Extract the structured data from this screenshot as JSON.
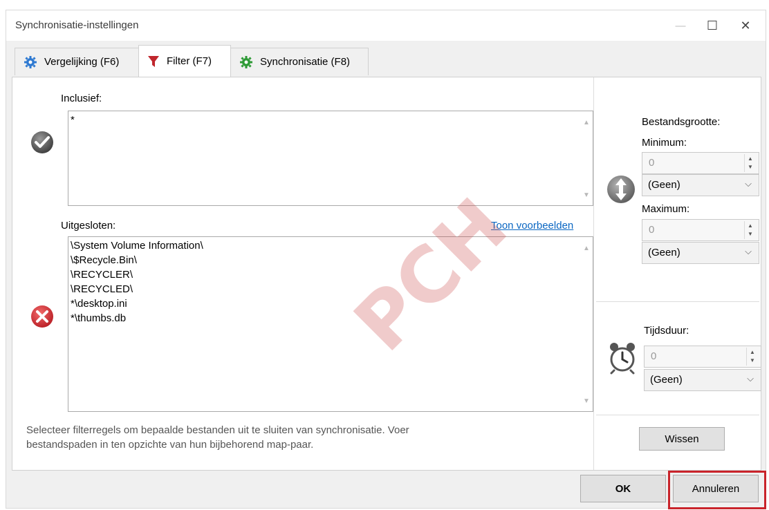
{
  "window": {
    "title": "Synchronisatie-instellingen",
    "controls": {
      "minimize": "—",
      "maximize": "☐",
      "close": "✕"
    }
  },
  "tabs": [
    {
      "label": "Vergelijking (F6)",
      "icon": "gear-icon-blue"
    },
    {
      "label": "Filter (F7)",
      "icon": "funnel-icon",
      "active": true
    },
    {
      "label": "Synchronisatie (F8)",
      "icon": "gear-icon-green"
    }
  ],
  "filter": {
    "include_label": "Inclusief:",
    "include_value": "*",
    "exclude_label": "Uitgesloten:",
    "show_examples": "Toon voorbeelden",
    "exclude_lines": [
      "\\System Volume Information\\",
      "\\$Recycle.Bin\\",
      "\\RECYCLER\\",
      "\\RECYCLED\\",
      "*\\desktop.ini",
      "*\\thumbs.db"
    ],
    "help_text_line1": "Selecteer filterregels om bepaalde bestanden uit te sluiten van synchronisatie. Voer",
    "help_text_line2": "bestandspaden in ten opzichte van hun bijbehorend map-paar."
  },
  "size": {
    "heading": "Bestandsgrootte:",
    "min_label": "Minimum:",
    "min_value": "0",
    "min_unit": "(Geen)",
    "max_label": "Maximum:",
    "max_value": "0",
    "max_unit": "(Geen)"
  },
  "time": {
    "label": "Tijdsduur:",
    "value": "0",
    "unit": "(Geen)"
  },
  "buttons": {
    "clear": "Wissen",
    "ok": "OK",
    "cancel": "Annuleren"
  },
  "watermark": "PCH",
  "colors": {
    "accent_link": "#0a66c2",
    "highlight": "#c9232a",
    "watermark": "#c84646"
  }
}
